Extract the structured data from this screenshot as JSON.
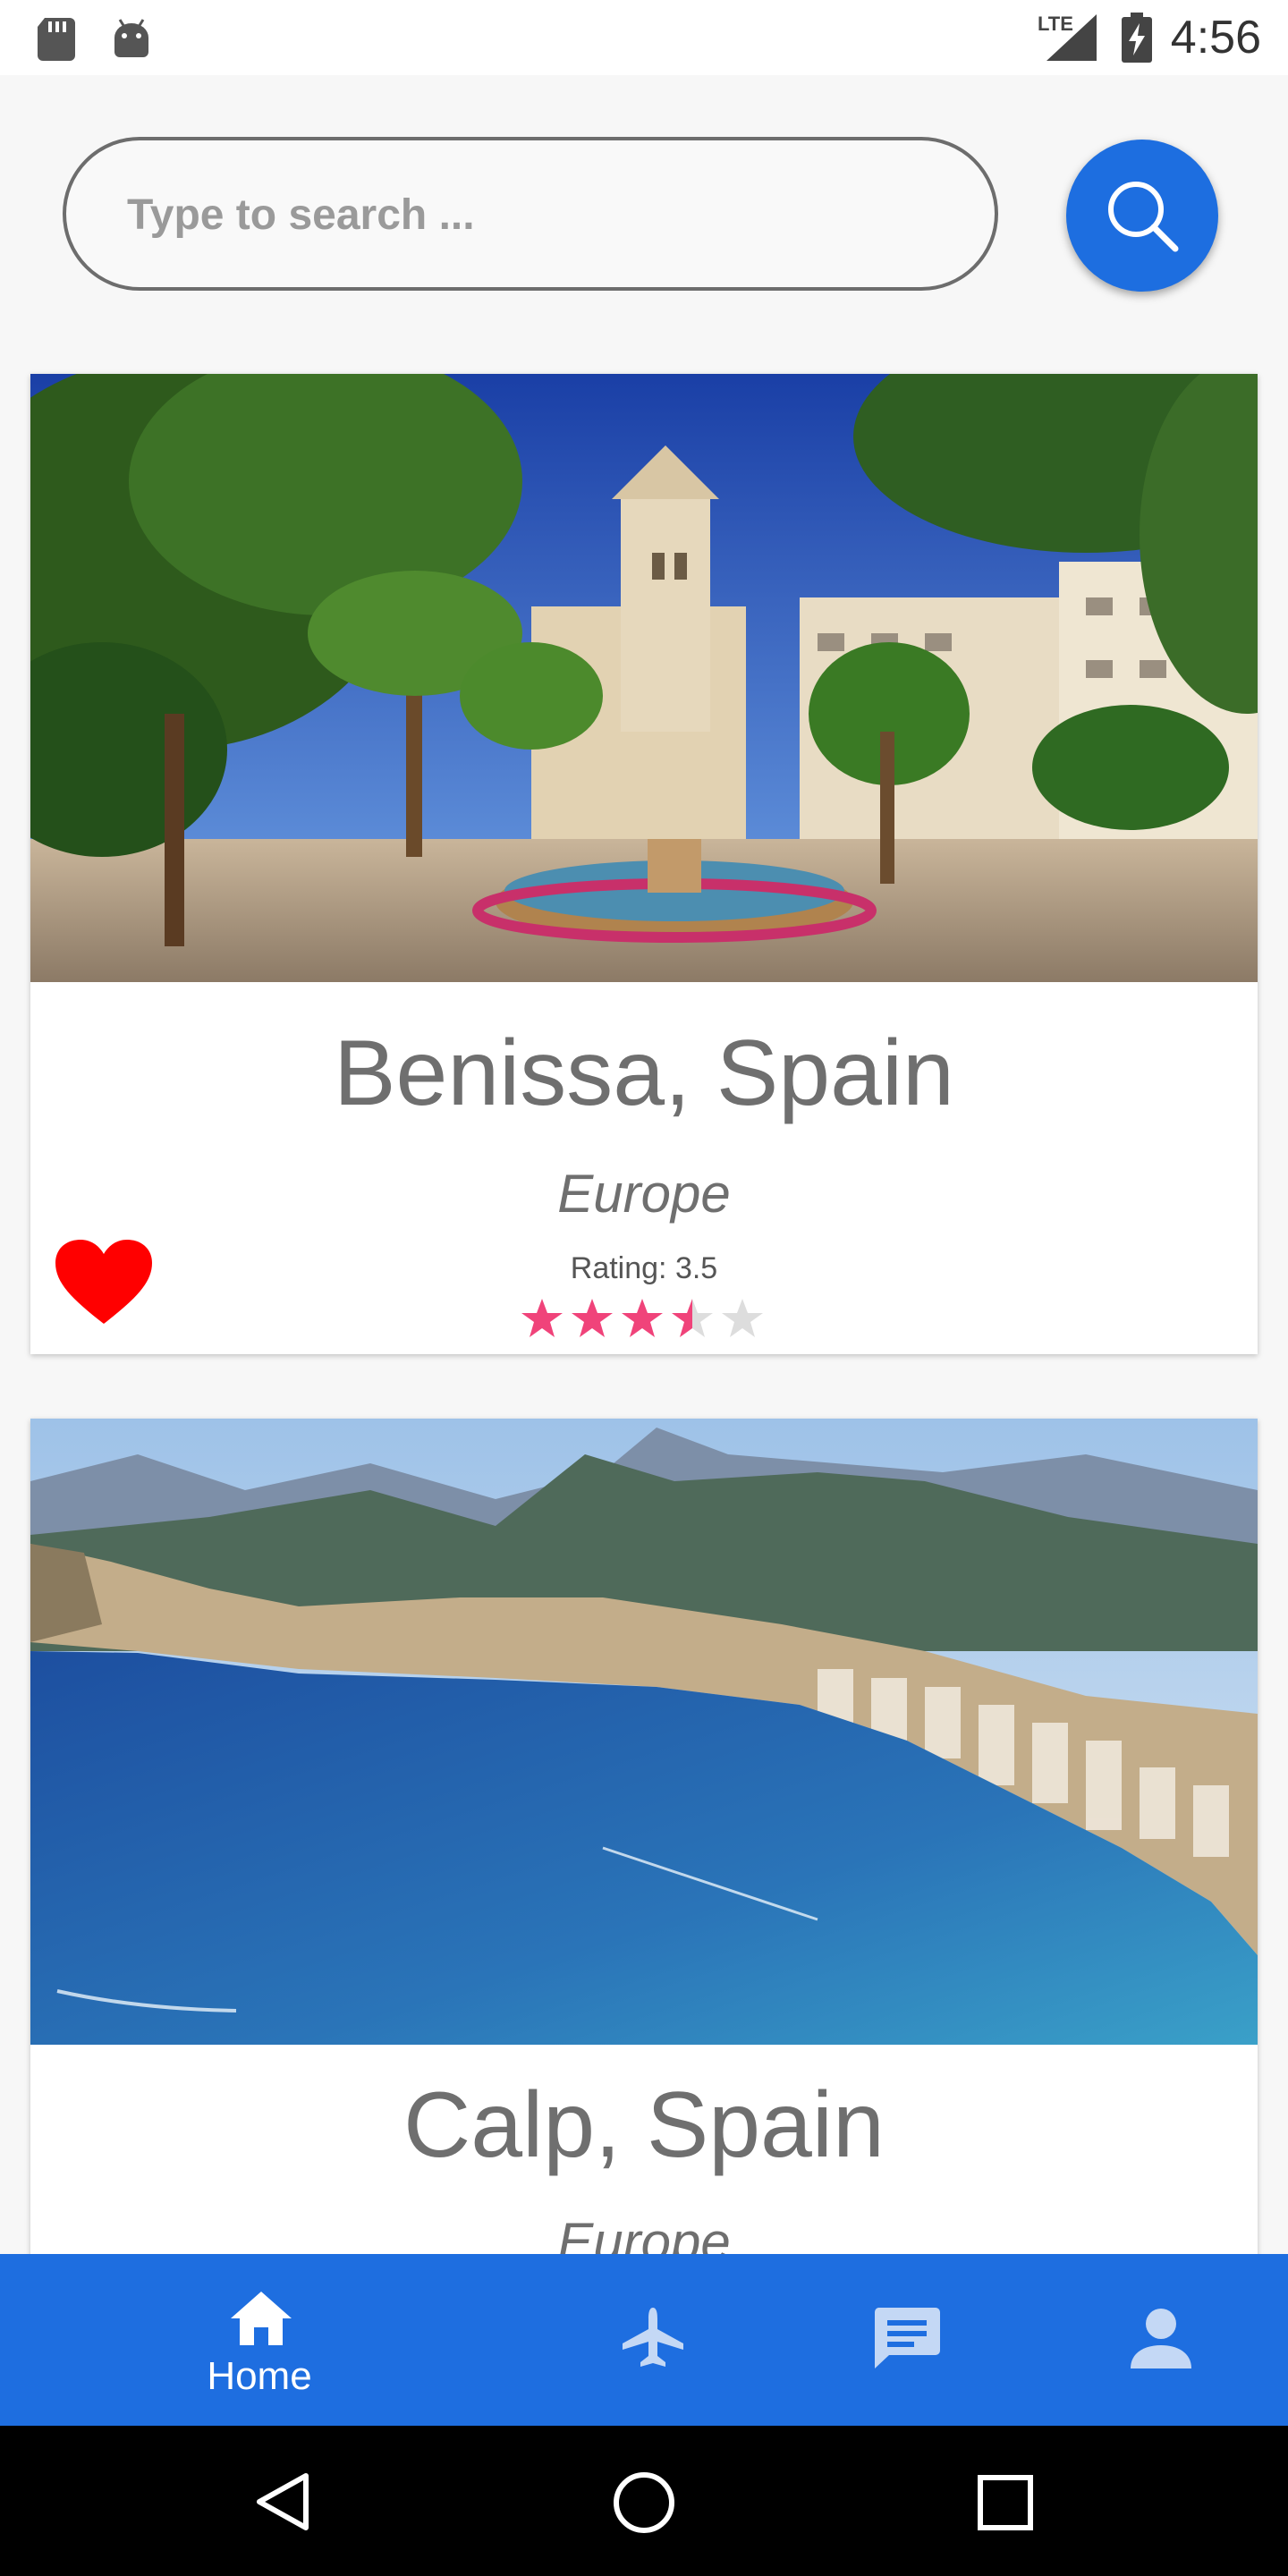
{
  "status_bar": {
    "time": "4:56",
    "network": "LTE",
    "icons": [
      "sd-card-icon",
      "android-debug-icon",
      "signal-icon",
      "battery-charging-icon"
    ]
  },
  "search": {
    "placeholder": "Type to search ...",
    "value": "",
    "button_icon": "search-icon"
  },
  "destinations": [
    {
      "title": "Benissa, Spain",
      "region": "Europe",
      "rating_label": "Rating: 3.5",
      "rating": 3.5,
      "rating_max": 5,
      "favorite": true,
      "photo": "town-square-fountain-church-palms"
    },
    {
      "title": "Calp, Spain",
      "region": "Europe",
      "photo": "coastal-bay-mountains"
    }
  ],
  "bottom_nav": {
    "items": [
      {
        "label": "Home",
        "icon": "home-icon",
        "active": true
      },
      {
        "label": "",
        "icon": "airplane-icon",
        "active": false
      },
      {
        "label": "",
        "icon": "chat-icon",
        "active": false
      },
      {
        "label": "",
        "icon": "person-icon",
        "active": false
      }
    ]
  },
  "system_nav": [
    "back-icon",
    "home-circle-icon",
    "recents-icon"
  ],
  "colors": {
    "primary": "#1E6EE0",
    "favorite": "#FF0000",
    "star_filled": "#F0437A",
    "star_empty": "#DDDDDD",
    "text": "#6F6F6F"
  }
}
